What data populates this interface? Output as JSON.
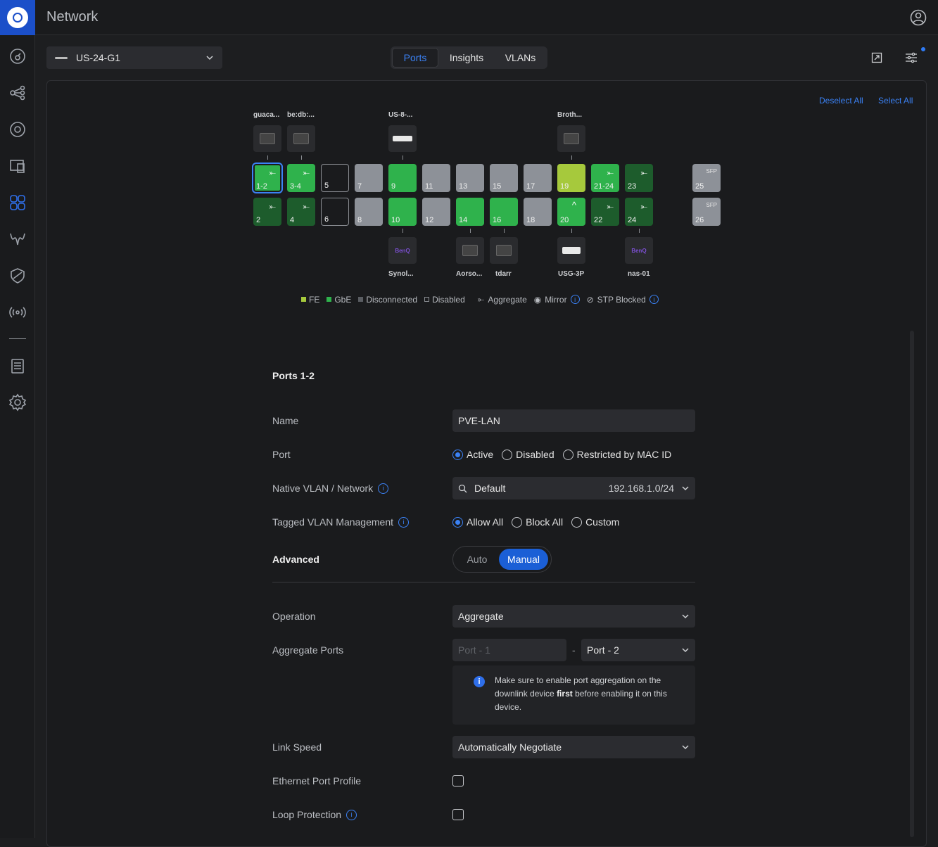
{
  "app": {
    "title": "Network"
  },
  "device": {
    "name": "US-24-G1"
  },
  "tabs": [
    {
      "label": "Ports",
      "active": true
    },
    {
      "label": "Insights",
      "active": false
    },
    {
      "label": "VLANs",
      "active": false
    }
  ],
  "panel": {
    "deselect_all": "Deselect All",
    "select_all": "Select All"
  },
  "devices_top": [
    {
      "label": "guaca...",
      "icon": "monitor-icon"
    },
    {
      "label": "be:db:...",
      "icon": "monitor-icon"
    },
    {
      "label": "US-8-...",
      "icon": "switch-icon"
    },
    {
      "label": "Broth...",
      "icon": "monitor-icon"
    }
  ],
  "devices_bottom": [
    {
      "label": "Synol...",
      "icon": "benq-icon",
      "logo_text": "BenQ"
    },
    {
      "label": "Aorso...",
      "icon": "monitor-icon"
    },
    {
      "label": "tdarr",
      "icon": "monitor-icon"
    },
    {
      "label": "USG-3P",
      "icon": "gateway-icon"
    },
    {
      "label": "nas-01",
      "icon": "benq-icon",
      "logo_text": "BenQ"
    }
  ],
  "ports_top": [
    "1-2",
    "3-4",
    "5",
    "7",
    "9",
    "11",
    "13",
    "15",
    "17",
    "19",
    "21-24",
    "23",
    "25"
  ],
  "ports_bottom": [
    "2",
    "4",
    "6",
    "8",
    "10",
    "12",
    "14",
    "16",
    "18",
    "20",
    "22",
    "24",
    "26"
  ],
  "sfp_label": "SFP",
  "legend": {
    "fe": "FE",
    "gbe": "GbE",
    "disconnected": "Disconnected",
    "disabled": "Disabled",
    "aggregate": "Aggregate",
    "mirror": "Mirror",
    "stp_blocked": "STP Blocked"
  },
  "colors": {
    "accent": "#3b82f6",
    "gbe": "#2fb24c",
    "fe": "#a6c93c",
    "disconnected": "#8d9198"
  },
  "form": {
    "title": "Ports 1-2",
    "name_label": "Name",
    "name_value": "PVE-LAN",
    "port_label": "Port",
    "port_options": [
      "Active",
      "Disabled",
      "Restricted by MAC ID"
    ],
    "port_selected": "Active",
    "native_vlan_label": "Native VLAN / Network",
    "native_vlan_value": "Default",
    "native_vlan_subnet": "192.168.1.0/24",
    "tagged_label": "Tagged VLAN Management",
    "tagged_options": [
      "Allow All",
      "Block All",
      "Custom"
    ],
    "tagged_selected": "Allow All",
    "advanced_label": "Advanced",
    "advanced_options": [
      "Auto",
      "Manual"
    ],
    "advanced_selected": "Manual",
    "operation_label": "Operation",
    "operation_value": "Aggregate",
    "aggregate_label": "Aggregate Ports",
    "aggregate_from_placeholder": "Port - 1",
    "aggregate_separator": "-",
    "aggregate_to_value": "Port - 2",
    "notice_pre": "Make sure to enable port aggregation on the downlink device ",
    "notice_bold": "first",
    "notice_post": " before enabling it on this device.",
    "notice_icon": "i",
    "link_speed_label": "Link Speed",
    "link_speed_value": "Automatically Negotiate",
    "eth_profile_label": "Ethernet Port Profile",
    "loop_label": "Loop Protection"
  }
}
